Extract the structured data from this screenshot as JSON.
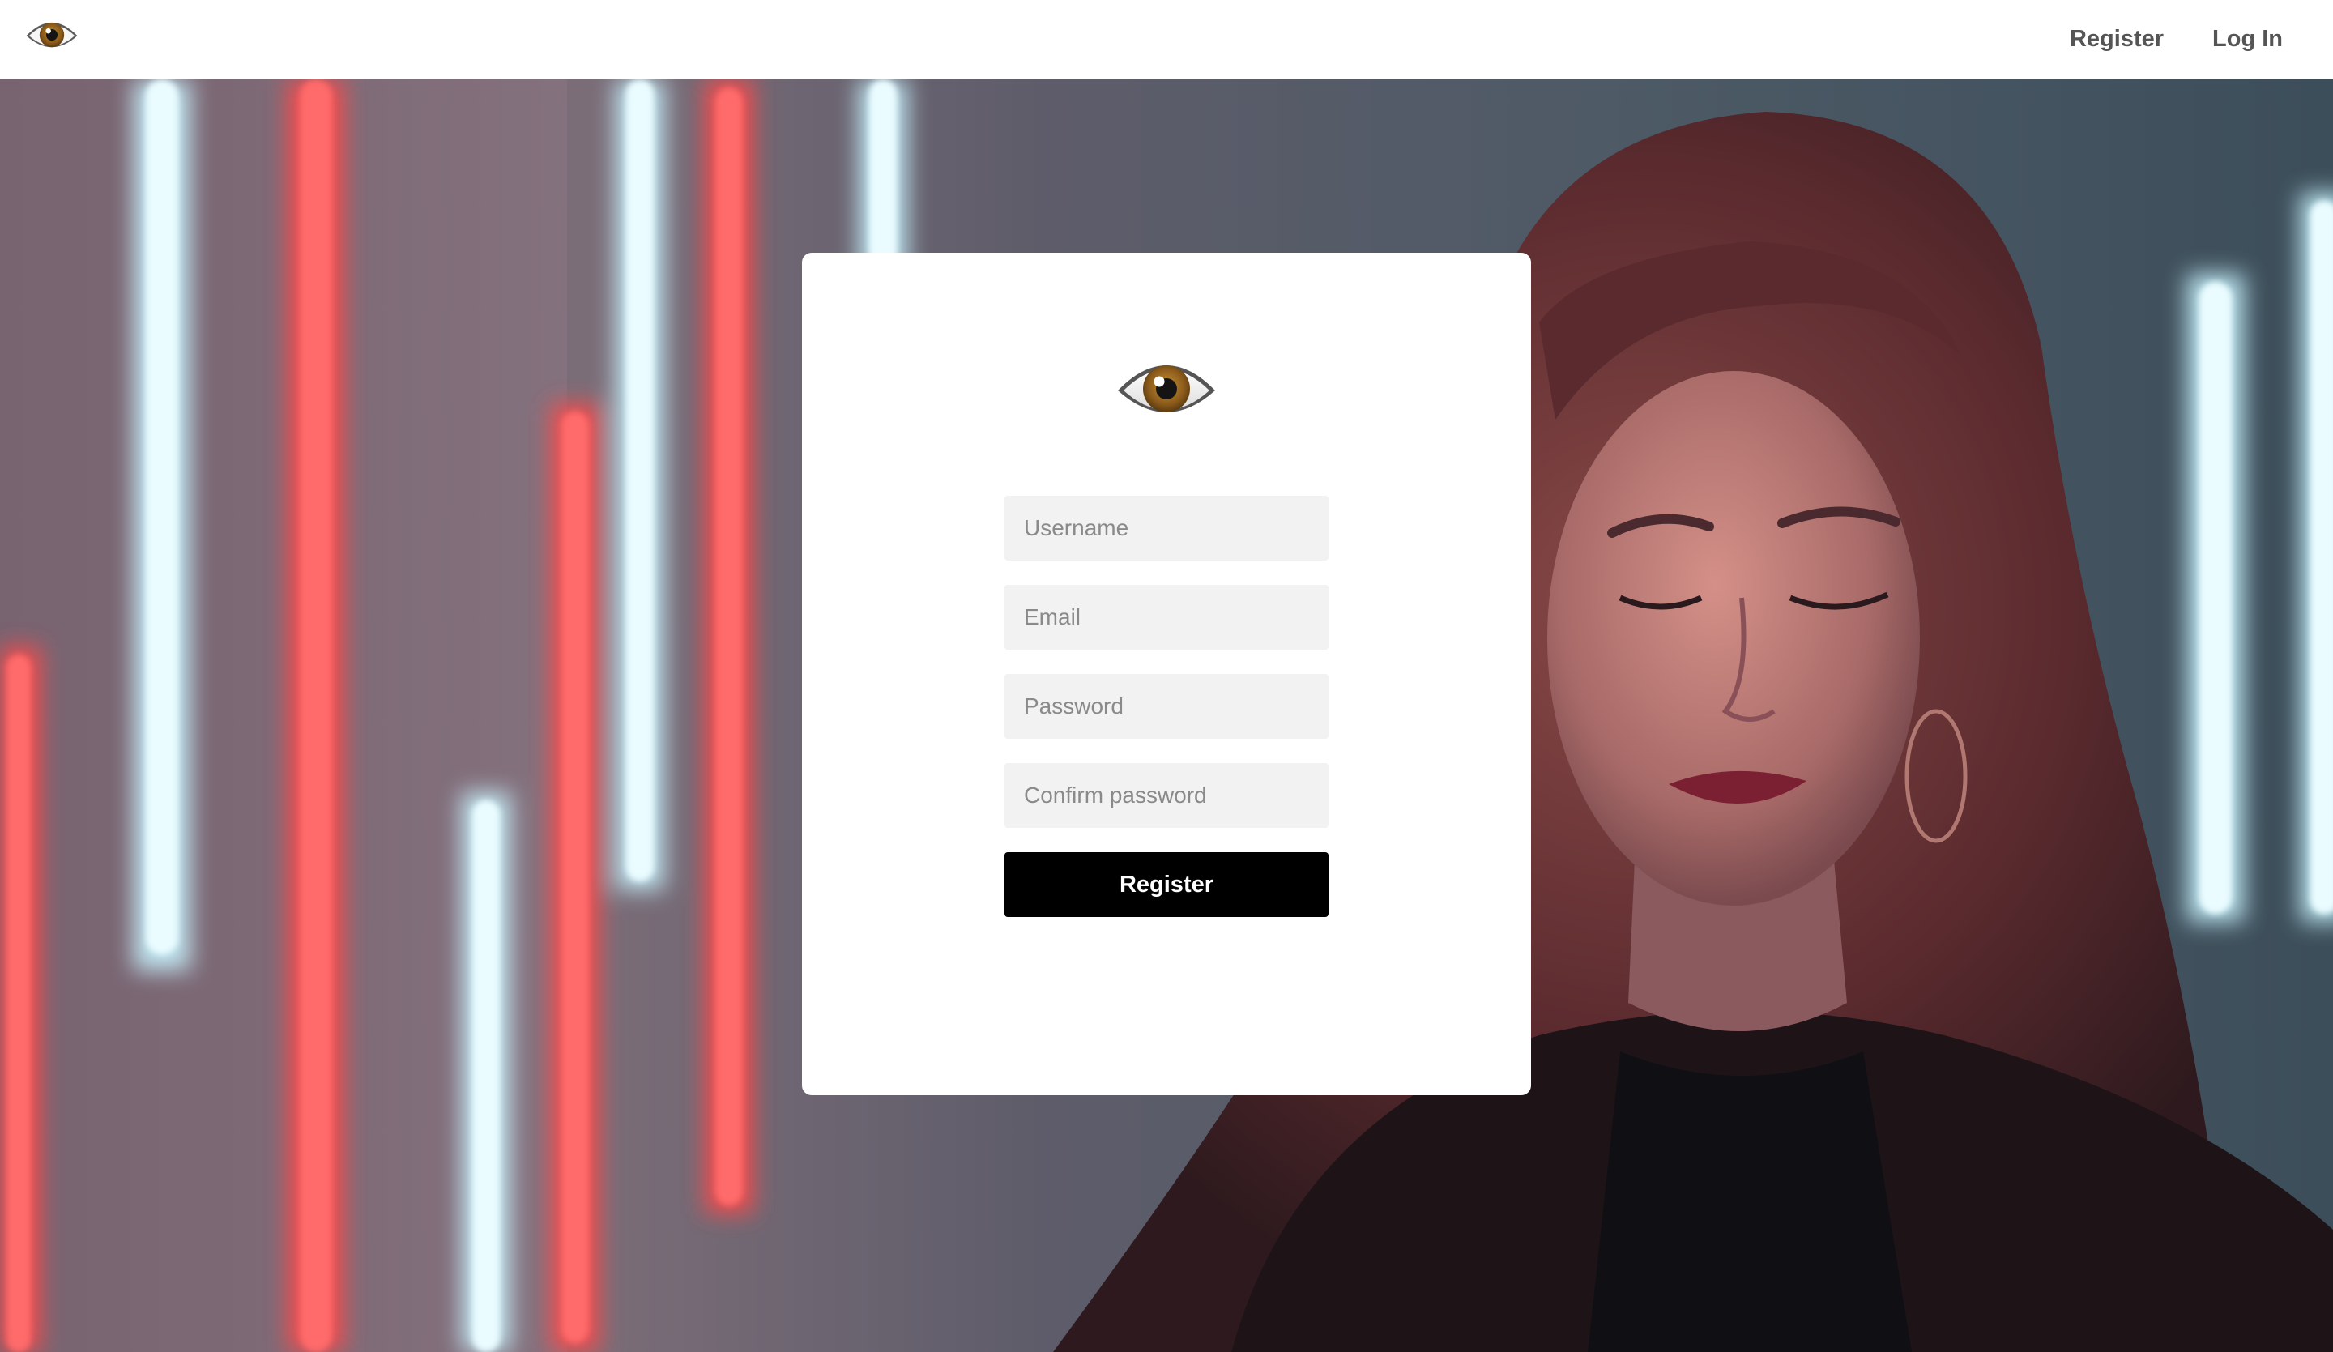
{
  "nav": {
    "logo_icon": "eye-icon",
    "links": [
      {
        "label": "Register"
      },
      {
        "label": "Log In"
      }
    ]
  },
  "hero": {
    "background": "photo of a woman with long wavy hair in front of red and cyan neon light tubes"
  },
  "form": {
    "logo_icon": "eye-icon",
    "username": {
      "placeholder": "Username",
      "value": ""
    },
    "email": {
      "placeholder": "Email",
      "value": ""
    },
    "password": {
      "placeholder": "Password",
      "value": ""
    },
    "confirm_password": {
      "placeholder": "Confirm password",
      "value": ""
    },
    "submit_label": "Register"
  },
  "colors": {
    "button_bg": "#000000",
    "button_text": "#ffffff",
    "input_bg": "#f2f2f2",
    "nav_link": "#555555",
    "neon_red": "#ff4a4a",
    "neon_cyan": "#c8f4ff"
  }
}
